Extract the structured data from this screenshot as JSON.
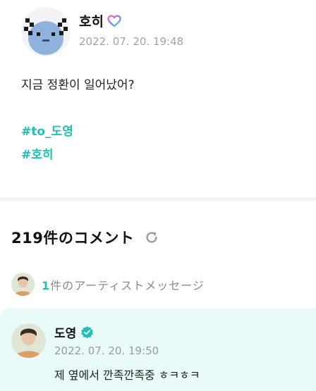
{
  "post": {
    "author": "호히",
    "timestamp": "2022. 07. 20. 19:48",
    "text": "지금 정환이 일어났어?",
    "hashtags": [
      "#to_도영",
      "#호히"
    ],
    "badge_icon": "heart-badge-icon"
  },
  "comments": {
    "count_label": "219件のコメント",
    "refresh_icon": "refresh-icon",
    "artist_message": {
      "count": "1",
      "label": "件のアーティストメッセージ"
    }
  },
  "comment": {
    "author": "도영",
    "verified_icon": "verified-badge-icon",
    "timestamp": "2022. 07. 20. 19:50",
    "text": "제 옆에서 깐족깐족중 ㅎㅋㅎㅋ"
  },
  "colors": {
    "accent": "#20bfb4",
    "card_bg": "#e9fbf8",
    "muted": "#a3a3a3"
  }
}
